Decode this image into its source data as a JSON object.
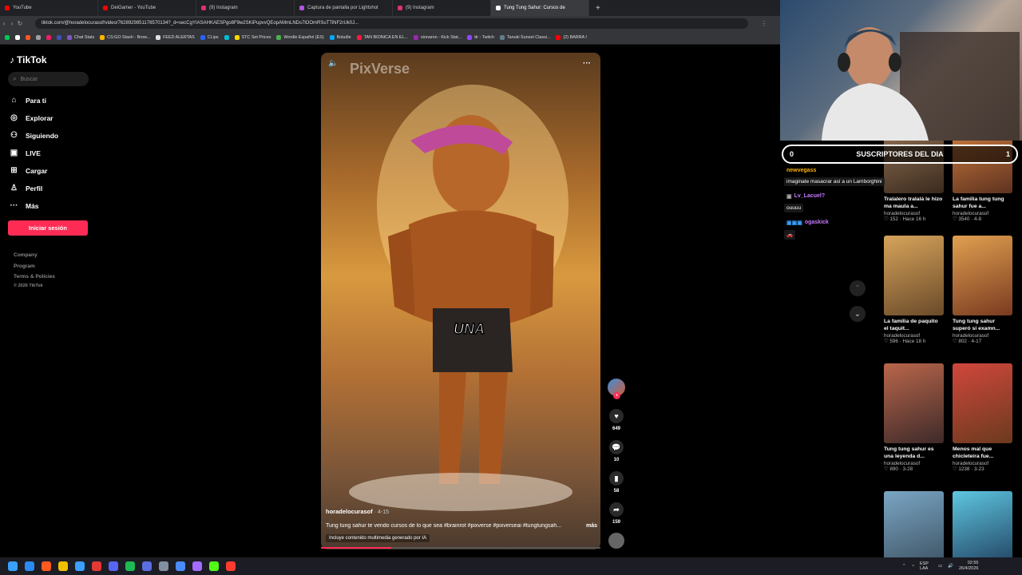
{
  "browser": {
    "tabs": [
      {
        "label": "YouTube",
        "color": "#ff0000"
      },
      {
        "label": "DeiGamer - YouTube",
        "color": "#ff0000"
      },
      {
        "label": "(9) Instagram",
        "color": "#e1306c"
      },
      {
        "label": "Captura de pantalla por Lightshot",
        "color": "#b455e0"
      },
      {
        "label": "(9) Instagram",
        "color": "#e1306c"
      },
      {
        "label": "Tung Tung Sahur: Cursos de",
        "color": "#ffffff",
        "active": true
      }
    ],
    "url": "tiktok.com/@horadelocurasof/video/7628929851176570134?_d=secCgYIASAHKAESPgo8F9w2SKiPupvvQEopAMmLNDs7lOOmRSuTTiNF2rUk0J...",
    "bookmarks": [
      {
        "label": "",
        "color": "#00c853"
      },
      {
        "label": "",
        "color": "#ffffff"
      },
      {
        "label": "",
        "color": "#ff5722"
      },
      {
        "label": "",
        "color": "#9e9e9e"
      },
      {
        "label": "",
        "color": "#e91e63"
      },
      {
        "label": "",
        "color": "#3f51b5"
      },
      {
        "label": "Chat Stats",
        "color": "#7e57c2"
      },
      {
        "label": "CS:GO Stash - Brow...",
        "color": "#ffb300"
      },
      {
        "label": "FEED ALERTAS",
        "color": "#e0e0e0"
      },
      {
        "label": "CLips",
        "color": "#2962ff"
      },
      {
        "label": "",
        "color": "#00bcd4"
      },
      {
        "label": "STC Set Prices",
        "color": "#ffd600"
      },
      {
        "label": "Wordle Español (ES)",
        "color": "#4caf50"
      },
      {
        "label": "Boludle",
        "color": "#03a9f4"
      },
      {
        "label": "TAN BIONICA EN EL...",
        "color": "#ff1744"
      },
      {
        "label": "sionaron - Kick Stat...",
        "color": "#9c27b0"
      },
      {
        "label": "ttr - Twitch",
        "color": "#9146ff"
      },
      {
        "label": "Tanuki Sunset Classi...",
        "color": "#607d8b"
      },
      {
        "label": "(2) BARRA I",
        "color": "#ff0000"
      }
    ]
  },
  "tiktok": {
    "logo": "TikTok",
    "search_placeholder": "Buscar",
    "nav": [
      {
        "label": "Para ti",
        "icon": "home-icon",
        "glyph": "⌂"
      },
      {
        "label": "Explorar",
        "icon": "compass-icon",
        "glyph": "◎"
      },
      {
        "label": "Siguiendo",
        "icon": "following-icon",
        "glyph": "⚇"
      },
      {
        "label": "LIVE",
        "icon": "live-icon",
        "glyph": "▣"
      },
      {
        "label": "Cargar",
        "icon": "upload-icon",
        "glyph": "⊞"
      },
      {
        "label": "Perfil",
        "icon": "profile-icon",
        "glyph": "♙"
      },
      {
        "label": "Más",
        "icon": "more-icon",
        "glyph": "···"
      }
    ],
    "login_label": "Iniciar sesión",
    "footer": [
      "Company",
      "Program",
      "Terms & Policies",
      "© 2026 TikTok"
    ],
    "video": {
      "watermark": "PixVerse",
      "overlay_text": "UNA",
      "author": "horadelocurasof",
      "date": "· 4-15",
      "description": "Tung tung sahur te vendo cursos de lo que sea #brainrot #pixverse #pixverseai #tungtungsah...",
      "more_label": "más",
      "ai_notice": "Incluye contenido multimedia generado por IA",
      "likes": "649",
      "comments": "10",
      "saves": "58",
      "shares": "159",
      "progress": 0.25
    },
    "recommended": [
      {
        "title": "Tralalero tralalá le hizo ma maula a...",
        "author": "horadelocurasof",
        "stats": "♡ 152 · Hace 16 h",
        "color1": "#8a6a4e",
        "color2": "#3a2a1e"
      },
      {
        "title": "La familia tung tung sahur fue a...",
        "author": "horadelocurasof",
        "stats": "♡ 3540 · 4-8",
        "color1": "#c4763a",
        "color2": "#5e3220"
      },
      {
        "title": "La familia de paquito el taquit...",
        "author": "horadelocurasof",
        "stats": "♡ 596 · Hace 18 h",
        "color1": "#d6a35a",
        "color2": "#6a4a2a"
      },
      {
        "title": "Tung tung sahur superó si examn...",
        "author": "horadelocurasof",
        "stats": "♡ 802 · 4-17",
        "color1": "#e0a050",
        "color2": "#7a3a20"
      },
      {
        "title": "Tung tung sahur es una leyenda d...",
        "author": "horadelocurasof",
        "stats": "♡ 890 · 3-28",
        "color1": "#b9664a",
        "color2": "#3e2a2a"
      },
      {
        "title": "Menos mal que chicleteira fue...",
        "author": "horadelocurasof",
        "stats": "♡ 1238 · 3-23",
        "color1": "#d0473c",
        "color2": "#6b3a1e"
      },
      {
        "title": "",
        "author": "",
        "stats": "",
        "color1": "#7aa6c4",
        "color2": "#3a4e5e"
      },
      {
        "title": "",
        "author": "",
        "stats": "",
        "color1": "#5ec6e0",
        "color2": "#1e3a5a"
      }
    ]
  },
  "stream": {
    "subs_left": "0",
    "subs_label": "SUSCRIPTORES DEL DIA",
    "subs_right": "1",
    "chat": [
      {
        "name": "newvegass",
        "message": "imaginate masacrar así a un Lamborghini",
        "color": "#ffb300"
      },
      {
        "name": "Lv_Lacuel?",
        "message": "ouuuu",
        "color": "#c779ff"
      },
      {
        "name": "ogaskick",
        "message": "🚗",
        "color": "#c779ff"
      }
    ]
  },
  "taskbar": {
    "apps": [
      "#2a8bf2",
      "#ff5a1f",
      "#f0c000",
      "#3aa0ff",
      "#e53935",
      "#5865f2",
      "#1db954",
      "#5b6ee1",
      "#8090a0",
      "#4a8cff",
      "#a46bff",
      "#53fc18",
      "#ff3b30"
    ],
    "lang": "ESP LAA",
    "time": "02:55",
    "date": "26/4/2026"
  }
}
